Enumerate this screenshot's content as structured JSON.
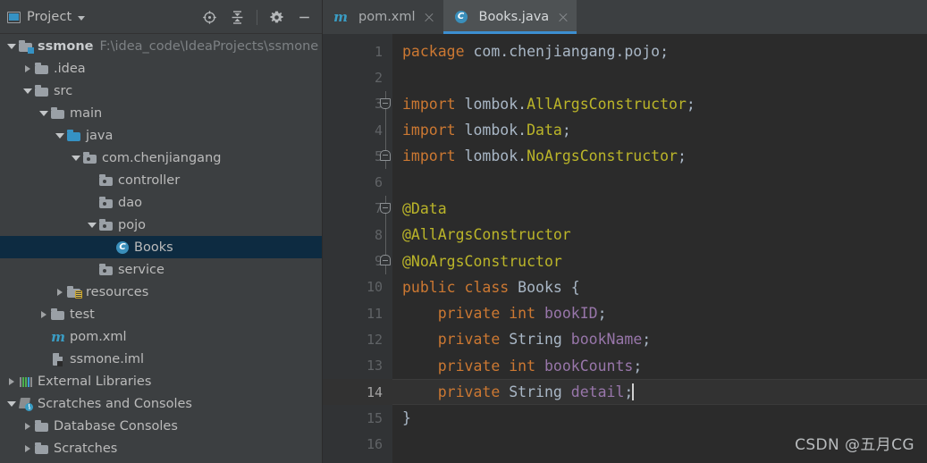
{
  "sidebar": {
    "panel_title": "Project",
    "panel_icon": "project-panel-icon",
    "tools": [
      {
        "name": "locate-icon",
        "title": "Select Opened File"
      },
      {
        "name": "collapse-all-icon",
        "title": "Collapse All"
      },
      {
        "name": "gear-icon",
        "title": "Settings"
      },
      {
        "name": "minimize-icon",
        "title": "Hide"
      }
    ],
    "tree": [
      {
        "label": "ssmone",
        "path": "F:\\idea_code\\IdeaProjects\\ssmone",
        "icon": "module-folder-icon",
        "arrow": "expanded",
        "indent": 0,
        "bold": true,
        "selected": false
      },
      {
        "label": ".idea",
        "path": "",
        "icon": "folder-icon",
        "arrow": "collapsed",
        "indent": 1,
        "bold": false,
        "selected": false
      },
      {
        "label": "src",
        "path": "",
        "icon": "folder-icon",
        "arrow": "expanded",
        "indent": 1,
        "bold": false,
        "selected": false
      },
      {
        "label": "main",
        "path": "",
        "icon": "folder-icon",
        "arrow": "expanded",
        "indent": 2,
        "bold": false,
        "selected": false
      },
      {
        "label": "java",
        "path": "",
        "icon": "source-folder-icon",
        "arrow": "expanded",
        "indent": 3,
        "bold": false,
        "selected": false
      },
      {
        "label": "com.chenjiangang",
        "path": "",
        "icon": "package-icon",
        "arrow": "expanded",
        "indent": 4,
        "bold": false,
        "selected": false
      },
      {
        "label": "controller",
        "path": "",
        "icon": "package-icon",
        "arrow": "none",
        "indent": 5,
        "bold": false,
        "selected": false
      },
      {
        "label": "dao",
        "path": "",
        "icon": "package-icon",
        "arrow": "none",
        "indent": 5,
        "bold": false,
        "selected": false
      },
      {
        "label": "pojo",
        "path": "",
        "icon": "package-icon",
        "arrow": "expanded",
        "indent": 5,
        "bold": false,
        "selected": false
      },
      {
        "label": "Books",
        "path": "",
        "icon": "java-class-icon",
        "arrow": "none",
        "indent": 6,
        "bold": false,
        "selected": true
      },
      {
        "label": "service",
        "path": "",
        "icon": "package-icon",
        "arrow": "none",
        "indent": 5,
        "bold": false,
        "selected": false
      },
      {
        "label": "resources",
        "path": "",
        "icon": "resources-folder-icon",
        "arrow": "collapsed",
        "indent": 3,
        "bold": false,
        "selected": false
      },
      {
        "label": "test",
        "path": "",
        "icon": "folder-icon",
        "arrow": "collapsed",
        "indent": 2,
        "bold": false,
        "selected": false
      },
      {
        "label": "pom.xml",
        "path": "",
        "icon": "maven-file-icon",
        "arrow": "none",
        "indent": 2,
        "bold": false,
        "selected": false
      },
      {
        "label": "ssmone.iml",
        "path": "",
        "icon": "iml-file-icon",
        "arrow": "none",
        "indent": 2,
        "bold": false,
        "selected": false
      },
      {
        "label": "External Libraries",
        "path": "",
        "icon": "external-libraries-icon",
        "arrow": "collapsed",
        "indent": 0,
        "bold": false,
        "selected": false
      },
      {
        "label": "Scratches and Consoles",
        "path": "",
        "icon": "scratches-icon",
        "arrow": "expanded",
        "indent": 0,
        "bold": false,
        "selected": false
      },
      {
        "label": "Database Consoles",
        "path": "",
        "icon": "folder-icon",
        "arrow": "collapsed",
        "indent": 1,
        "bold": false,
        "selected": false
      },
      {
        "label": "Scratches",
        "path": "",
        "icon": "folder-icon",
        "arrow": "collapsed",
        "indent": 1,
        "bold": false,
        "selected": false
      }
    ]
  },
  "editor": {
    "tabs": [
      {
        "label": "pom.xml",
        "icon": "maven-file-icon",
        "active": false
      },
      {
        "label": "Books.java",
        "icon": "java-class-icon",
        "active": true
      }
    ],
    "current_line": 14,
    "lines": [
      {
        "n": 1,
        "fold": "none",
        "tokens": [
          {
            "t": "package ",
            "c": "kw"
          },
          {
            "t": "com.chenjiangang.pojo;",
            "c": "pkgc"
          }
        ]
      },
      {
        "n": 2,
        "fold": "none",
        "tokens": []
      },
      {
        "n": 3,
        "fold": "start",
        "tokens": [
          {
            "t": "import ",
            "c": "kw"
          },
          {
            "t": "lombok.",
            "c": "pkgc"
          },
          {
            "t": "AllArgsConstructor",
            "c": "ann"
          },
          {
            "t": ";",
            "c": "pun"
          }
        ]
      },
      {
        "n": 4,
        "fold": "mid",
        "tokens": [
          {
            "t": "import ",
            "c": "kw"
          },
          {
            "t": "lombok.",
            "c": "pkgc"
          },
          {
            "t": "Data",
            "c": "ann"
          },
          {
            "t": ";",
            "c": "pun"
          }
        ]
      },
      {
        "n": 5,
        "fold": "end",
        "tokens": [
          {
            "t": "import ",
            "c": "kw"
          },
          {
            "t": "lombok.",
            "c": "pkgc"
          },
          {
            "t": "NoArgsConstructor",
            "c": "ann"
          },
          {
            "t": ";",
            "c": "pun"
          }
        ]
      },
      {
        "n": 6,
        "fold": "none",
        "tokens": []
      },
      {
        "n": 7,
        "fold": "start",
        "tokens": [
          {
            "t": "@Data",
            "c": "ann"
          }
        ]
      },
      {
        "n": 8,
        "fold": "mid",
        "tokens": [
          {
            "t": "@AllArgsConstructor",
            "c": "ann"
          }
        ]
      },
      {
        "n": 9,
        "fold": "end",
        "tokens": [
          {
            "t": "@NoArgsConstructor",
            "c": "ann"
          }
        ]
      },
      {
        "n": 10,
        "fold": "none",
        "tokens": [
          {
            "t": "public ",
            "c": "kw"
          },
          {
            "t": "class ",
            "c": "kw"
          },
          {
            "t": "Books ",
            "c": "cls2"
          },
          {
            "t": "{",
            "c": "pun"
          }
        ]
      },
      {
        "n": 11,
        "fold": "none",
        "tokens": [
          {
            "t": "    ",
            "c": "pun"
          },
          {
            "t": "private ",
            "c": "kw"
          },
          {
            "t": "int ",
            "c": "kw"
          },
          {
            "t": "bookID",
            "c": "fld"
          },
          {
            "t": ";",
            "c": "pun"
          }
        ]
      },
      {
        "n": 12,
        "fold": "none",
        "tokens": [
          {
            "t": "    ",
            "c": "pun"
          },
          {
            "t": "private ",
            "c": "kw"
          },
          {
            "t": "String ",
            "c": "typ"
          },
          {
            "t": "bookName",
            "c": "fld"
          },
          {
            "t": ";",
            "c": "pun"
          }
        ]
      },
      {
        "n": 13,
        "fold": "none",
        "tokens": [
          {
            "t": "    ",
            "c": "pun"
          },
          {
            "t": "private ",
            "c": "kw"
          },
          {
            "t": "int ",
            "c": "kw"
          },
          {
            "t": "bookCounts",
            "c": "fld"
          },
          {
            "t": ";",
            "c": "pun"
          }
        ]
      },
      {
        "n": 14,
        "fold": "none",
        "tokens": [
          {
            "t": "    ",
            "c": "pun"
          },
          {
            "t": "private ",
            "c": "kw"
          },
          {
            "t": "String ",
            "c": "typ"
          },
          {
            "t": "detail",
            "c": "fld"
          },
          {
            "t": ";",
            "c": "pun"
          }
        ]
      },
      {
        "n": 15,
        "fold": "none",
        "tokens": [
          {
            "t": "}",
            "c": "pun"
          }
        ]
      },
      {
        "n": 16,
        "fold": "none",
        "tokens": []
      }
    ]
  },
  "watermark": "CSDN @五月CG",
  "colors": {
    "sidebar_bg": "#3c3f41",
    "editor_bg": "#2b2b2b",
    "gutter_bg": "#313335",
    "selection_bg": "#0d2b41",
    "accent_blue": "#3d8fd1",
    "keyword": "#cc7832",
    "annotation": "#bbb529",
    "field": "#9876aa",
    "text": "#a9b7c6"
  }
}
